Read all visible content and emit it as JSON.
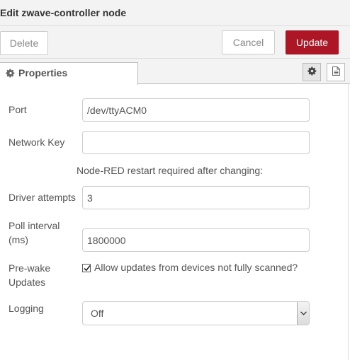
{
  "header": {
    "title": "Edit zwave-controller node"
  },
  "toolbar": {
    "delete_label": "Delete",
    "cancel_label": "Cancel",
    "update_label": "Update",
    "accent_color": "#ad1625"
  },
  "tabs": {
    "active_label": "Properties",
    "active_icon": "gear-icon",
    "side_icons": [
      "gear-icon",
      "document-icon"
    ]
  },
  "form": {
    "port": {
      "label": "Port",
      "value": "/dev/ttyACM0"
    },
    "network_key": {
      "label": "Network Key",
      "value": ""
    },
    "note": "Node-RED restart required after changing:",
    "driver_attempts": {
      "label": "Driver attempts",
      "value": "3"
    },
    "poll_interval": {
      "label_line1": "Poll interval",
      "label_line2": "(ms)",
      "value": "1800000"
    },
    "pre_wake": {
      "label_line1": "Pre-wake",
      "label_line2": "Updates",
      "checkbox_label": "Allow updates from devices not fully scanned?",
      "checked": true
    },
    "logging": {
      "label": "Logging",
      "selected": "Off"
    }
  }
}
